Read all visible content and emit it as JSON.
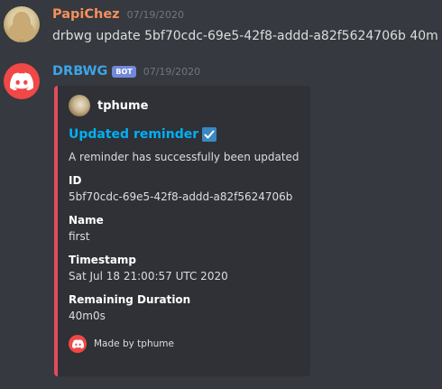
{
  "messages": [
    {
      "username": "PapiChez",
      "username_color": "#f5905c",
      "timestamp": "07/19/2020",
      "content": "drbwg update 5bf70cdc-69e5-42f8-addd-a82f5624706b 40m",
      "avatar_icon": "user-avatar"
    },
    {
      "username": "DRBWG",
      "username_color": "#3ca5e6",
      "bot_tag": "BOT",
      "timestamp": "07/19/2020",
      "avatar_icon": "discord-logo-icon"
    }
  ],
  "embed": {
    "accent_color": "#e24c5c",
    "author_name": "tphume",
    "title": "Updated reminder",
    "title_color": "#00b0f4",
    "title_icon": "check-box-icon",
    "description": "A reminder has successfully been updated",
    "fields": [
      {
        "name": "ID",
        "value": "5bf70cdc-69e5-42f8-addd-a82f5624706b"
      },
      {
        "name": "Name",
        "value": "first"
      },
      {
        "name": "Timestamp",
        "value": "Sat Jul 18 21:00:57 UTC 2020"
      },
      {
        "name": "Remaining Duration",
        "value": "40m0s"
      }
    ],
    "footer_text": "Made by tphume",
    "footer_icon": "discord-logo-icon"
  }
}
